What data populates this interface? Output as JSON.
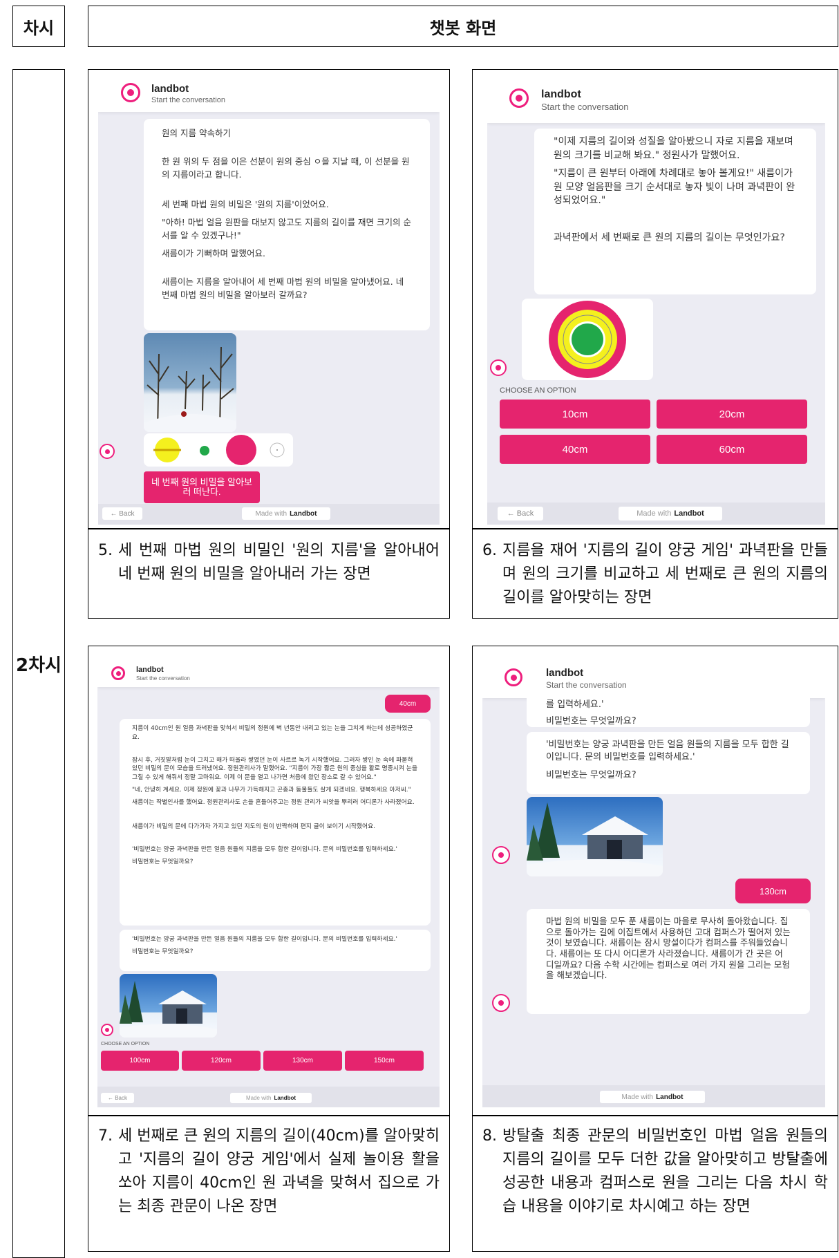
{
  "table": {
    "col_session_header": "차시",
    "col_screen_header": "챗봇 화면",
    "session_label": "2차시"
  },
  "bot": {
    "name": "landbot",
    "subtitle": "Start the conversation",
    "back_label": "Back",
    "made_with": "Made with",
    "made_with_brand": "Landbot",
    "choose_label": "CHOOSE AN OPTION"
  },
  "colors": {
    "accent_pink": "#e5246e",
    "chat_bg": "#ececf3",
    "target_yellow": "#f4f01e",
    "target_green": "#21a84a"
  },
  "panel5": {
    "msg_title": "원의 지름 약속하기",
    "msg_p1": "한 원 위의 두 점을 이은 선분이 원의 중심 ㅇ을 지날 때, 이 선분을 원의 지름이라고 합니다.",
    "msg_p2": "세 번째 마법 원의 비밀은 '원의 지름'이었어요.",
    "msg_p3": "\"아하! 마법 얼음 원판을 대보지 않고도 지름의 길이를 재면 크기의 순서를 알 수 있겠구나!\"",
    "msg_p4": "새름이가 기뻐하며 말했어요.",
    "msg_p5": "새름이는 지름을 알아내어 세 번째 마법 원의 비밀을 알아냈어요. 네 번째 마법 원의 비밀을 알아보러 갈까요?",
    "button": "네 번째 원의 비밀을 알아보러 떠난다.",
    "caption_num": "5.",
    "caption": "세 번째 마법 원의 비밀인 '원의 지름'을 알아내어 네 번째 원의 비밀을 알아내러 가는 장면"
  },
  "panel6": {
    "msg_p1": "\"이제 지름의 길이와 성질을 알아봤으니 자로 지름을 재보며 원의 크기를 비교해 봐요.\" 정원사가 말했어요.",
    "msg_p2": "\"지름이 큰 원부터 아래에 차례대로 놓아 볼게요!\" 새름이가 원 모양 얼음판을 크기 순서대로 놓자 빛이 나며 과녁판이 완성되었어요.\"",
    "msg_p3": "과녁판에서 세 번째로 큰 원의 지름의 길이는 무엇인가요?",
    "options": [
      "10cm",
      "20cm",
      "40cm",
      "60cm"
    ],
    "caption_num": "6.",
    "caption": "지름을 재어 '지름의 길이 양궁 게임' 과녁판을 만들며 원의 크기를 비교하고 세 번째로 큰 원의 지름의 길이를 알아맞히는 장면"
  },
  "panel7": {
    "user_answer": "40cm",
    "msg_p1": "지름이 40cm인 원 얼음 과녁판을 맞혀서 비밀의 정원에 벽 년동안 내리고 있는 눈을 그치게 하는데 성공하였군요.",
    "msg_p2": "잠시 후, 거짓말처럼 눈이 그치고 해가 떠올라 쌓였던 눈이 사르르 녹기 시작했어요. 그러자 쌓인 눈 속에 파묻혀 있던 비밀의 문이 모습을 드러냈어요. 정원관리사가 말했어요. \"지름이 가장 짧은 원의 중심을 활로 명중시켜 눈을 그칠 수 있게 해줘서 정말 고마워요. 이제 이 문을 열고 나가면 처음에 왔던 장소로 갈 수 있어요.\"",
    "msg_p3": "\"네, 안녕히 계세요. 이제 정원에 꽃과 나무가 가득해지고 곤충과 동물들도 살게 되겠네요. 행복하세요 아저씨.\"",
    "msg_p4": "새름이는 작별인사를 했어요. 정원관리사도 손을 흔들어주고는 정원 관리가 씨앗을 뿌리러 어디론가 사라졌어요.",
    "msg_p5": "새름이가 비밀의 문에 다가가자 가지고 있던 지도의 원이 반짝하며 편지 글이 보이기 시작했어요.",
    "msg_p6": "'비밀번호는 양궁 과녁판을 만든 얼음 원들의 지름을 모두 합한 길이입니다. 문의 비밀번호를 입력하세요.'",
    "msg_p7": "비밀번호는 무엇일까요?",
    "msg2_p1": "'비밀번호는 양궁 과녁판을 만든 얼음 원들의 지름을 모두 합한 길이입니다. 문의 비밀번호를 입력하세요.'",
    "msg2_p2": "비밀번호는 무엇일까요?",
    "options": [
      "100cm",
      "120cm",
      "130cm",
      "150cm"
    ],
    "caption_num": "7.",
    "caption": "세 번째로 큰 원의 지름의 길이(40cm)를 알아맞히고 '지름의 길이 양궁 게임'에서 실제 놀이용 활을 쏘아 지름이 40cm인 원 과녁을 맞혀서 집으로 가는 최종 관문이 나온 장면"
  },
  "panel8": {
    "msg_top1": "를 입력하세요.'",
    "msg_top2": "비밀번호는 무엇일까요?",
    "msg_p1": "'비밀번호는 양궁 과녁판을 만든 얼음 원들의 지름을 모두 합한 길이입니다. 문의 비밀번호를 입력하세요.'",
    "msg_p2": "비밀번호는 무엇일까요?",
    "user_answer": "130cm",
    "msg_final": "마법 원의 비밀을 모두 푼 새름이는 마을로 무사히 돌아왔습니다. 집으로 돌아가는 길에 이집트에서 사용하던 고대 컴퍼스가 떨어져 있는 것이 보였습니다. 새름이는 잠시 망설이다가 컴퍼스를 주워들었습니다. 새름이는 또 다시 어디론가 사라졌습니다. 새름이가 간 곳은 어디일까요? 다음 수학 시간에는 컴퍼스로 여러 가지 원을 그리는 모험을 해보겠습니다.",
    "caption_num": "8.",
    "caption": "방탈출 최종 관문의 비밀번호인 마법 얼음 원들의 지름의 길이를 모두 더한 값을 알아맞히고 방탈출에 성공한 내용과 컴퍼스로 원을 그리는 다음 차시 학습 내용을 이야기로 차시예고 하는 장면"
  }
}
